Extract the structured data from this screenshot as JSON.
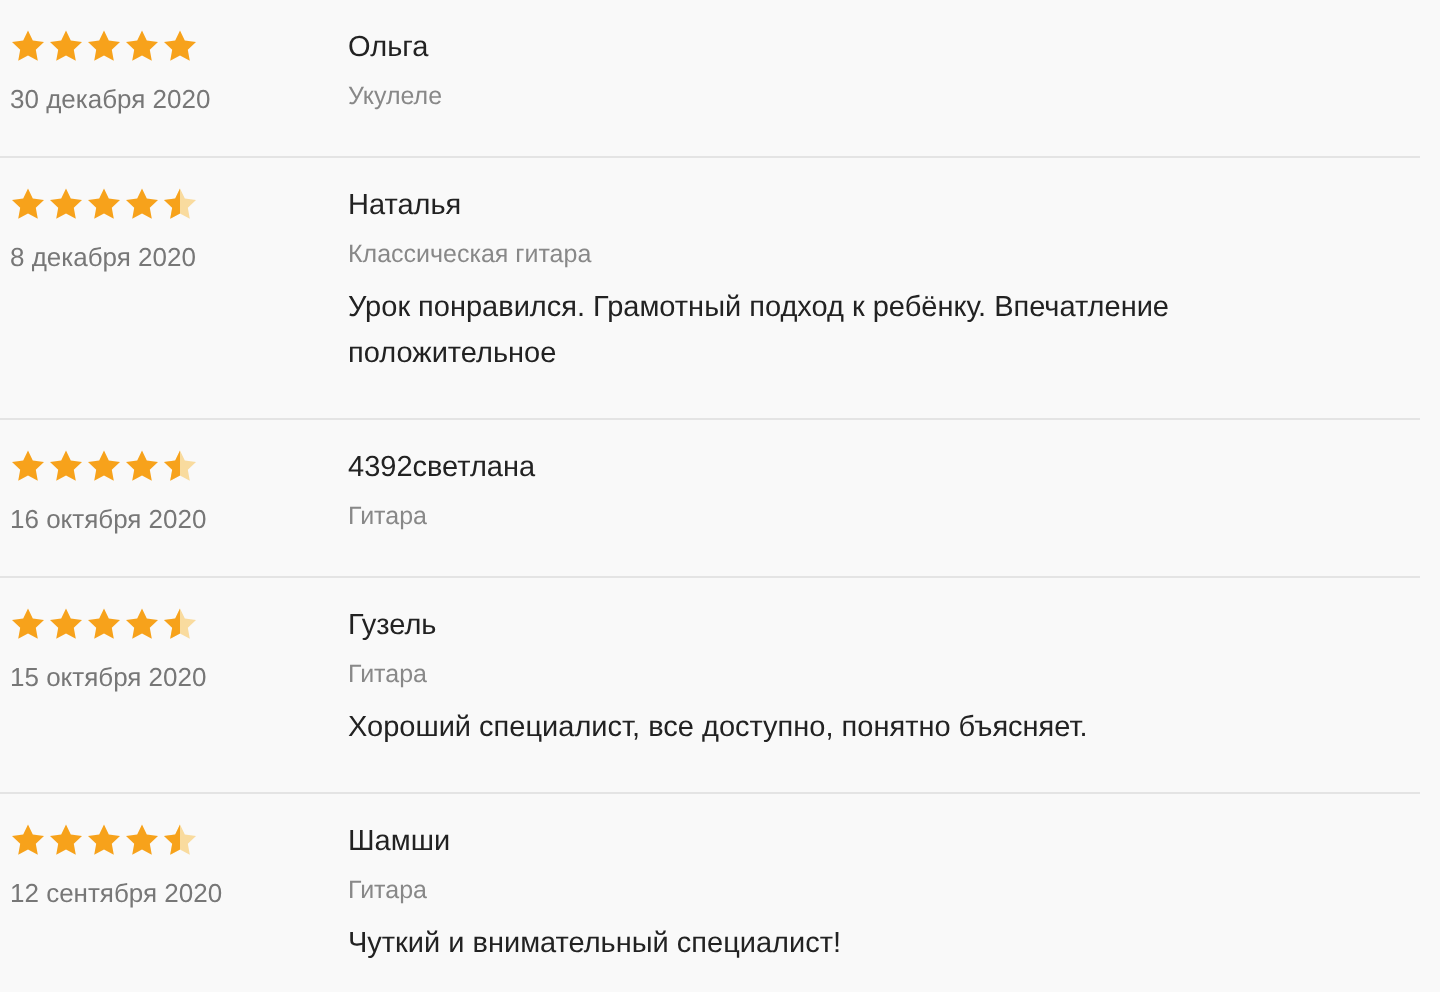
{
  "reviews": [
    {
      "stars": 5,
      "date": "30 декабря 2020",
      "author": "Ольга",
      "subject": "Укулеле"
    },
    {
      "stars": 4.5,
      "date": "8 декабря 2020",
      "author": "Наталья",
      "subject": "Классическая гитара",
      "text": "Урок понравился. Грамотный подход к ребёнку. Впечатление положительное"
    },
    {
      "stars": 4.5,
      "date": "16 октября 2020",
      "author": "4392светлана",
      "subject": "Гитара"
    },
    {
      "stars": 4.5,
      "date": "15 октября 2020",
      "author": "Гузель",
      "subject": "Гитара",
      "text": "Хороший специалист, все доступно, понятно бъясняет."
    },
    {
      "stars": 4.5,
      "date": "12 сентября 2020",
      "author": "Шамши",
      "subject": "Гитара",
      "text": "Чуткий и внимательный специалист!"
    }
  ]
}
